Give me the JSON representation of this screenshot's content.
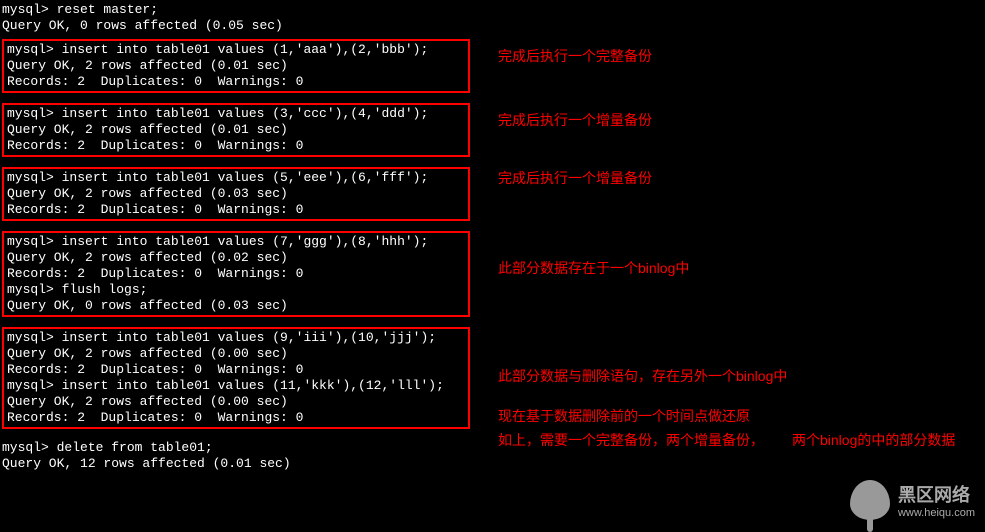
{
  "intro": {
    "line1": "mysql> reset master;",
    "line2": "Query OK, 0 rows affected (0.05 sec)"
  },
  "block1": {
    "l1": "mysql> insert into table01 values (1,'aaa'),(2,'bbb');",
    "l2": "Query OK, 2 rows affected (0.01 sec)",
    "l3": "Records: 2  Duplicates: 0  Warnings: 0"
  },
  "block2": {
    "l1": "mysql> insert into table01 values (3,'ccc'),(4,'ddd');",
    "l2": "Query OK, 2 rows affected (0.01 sec)",
    "l3": "Records: 2  Duplicates: 0  Warnings: 0"
  },
  "block3": {
    "l1": "mysql> insert into table01 values (5,'eee'),(6,'fff');",
    "l2": "Query OK, 2 rows affected (0.03 sec)",
    "l3": "Records: 2  Duplicates: 0  Warnings: 0"
  },
  "block4": {
    "l1": "mysql> insert into table01 values (7,'ggg'),(8,'hhh');",
    "l2": "Query OK, 2 rows affected (0.02 sec)",
    "l3": "Records: 2  Duplicates: 0  Warnings: 0",
    "l4": "",
    "l5": "mysql> flush logs;",
    "l6": "Query OK, 0 rows affected (0.03 sec)"
  },
  "block5": {
    "l1": "mysql> insert into table01 values (9,'iii'),(10,'jjj');",
    "l2": "Query OK, 2 rows affected (0.00 sec)",
    "l3": "Records: 2  Duplicates: 0  Warnings: 0",
    "l4": "",
    "l5": "mysql> insert into table01 values (11,'kkk'),(12,'lll');",
    "l6": "Query OK, 2 rows affected (0.00 sec)",
    "l7": "Records: 2  Duplicates: 0  Warnings: 0"
  },
  "outro": {
    "l1": "mysql> delete from table01;",
    "l2": "Query OK, 12 rows affected (0.01 sec)"
  },
  "annotations": {
    "a1": "完成后执行一个完整备份",
    "a2": "完成后执行一个增量备份",
    "a3": "完成后执行一个增量备份",
    "a4": "此部分数据存在于一个binlog中",
    "a5": "此部分数据与删除语句，存在另外一个binlog中",
    "a6": "现在基于数据删除前的一个时间点做还原",
    "a7": "如上，需要一个完整备份，两个增量备份，",
    "a8": "两个binlog的中的部分数据"
  },
  "watermark": {
    "title": "黑区网络",
    "url": "www.heiqu.com"
  }
}
